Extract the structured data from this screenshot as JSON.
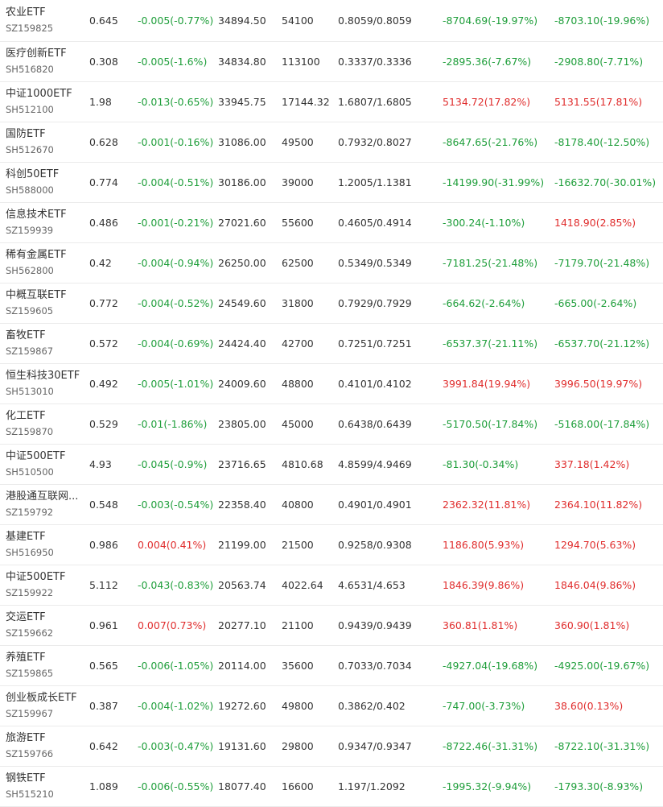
{
  "colors": {
    "up": "#e02d2d",
    "down": "#1e9e3a",
    "text": "#333333",
    "subtext": "#666666"
  },
  "rows": [
    {
      "name": "农业ETF",
      "code": "SZ159825",
      "price": "0.645",
      "change": "-0.005(-0.77%)",
      "dir": "down",
      "amount": "34894.50",
      "volume": "54100",
      "range": "0.8059/0.8059",
      "pl1": "-8704.69(-19.97%)",
      "pl1dir": "down",
      "pl2": "-8703.10(-19.96%)",
      "pl2dir": "down"
    },
    {
      "name": "医疗创新ETF",
      "code": "SH516820",
      "price": "0.308",
      "change": "-0.005(-1.6%)",
      "dir": "down",
      "amount": "34834.80",
      "volume": "113100",
      "range": "0.3337/0.3336",
      "pl1": "-2895.36(-7.67%)",
      "pl1dir": "down",
      "pl2": "-2908.80(-7.71%)",
      "pl2dir": "down"
    },
    {
      "name": "中证1000ETF",
      "code": "SH512100",
      "price": "1.98",
      "change": "-0.013(-0.65%)",
      "dir": "down",
      "amount": "33945.75",
      "volume": "17144.32",
      "range": "1.6807/1.6805",
      "pl1": "5134.72(17.82%)",
      "pl1dir": "up",
      "pl2": "5131.55(17.81%)",
      "pl2dir": "up"
    },
    {
      "name": "国防ETF",
      "code": "SH512670",
      "price": "0.628",
      "change": "-0.001(-0.16%)",
      "dir": "down",
      "amount": "31086.00",
      "volume": "49500",
      "range": "0.7932/0.8027",
      "pl1": "-8647.65(-21.76%)",
      "pl1dir": "down",
      "pl2": "-8178.40(-12.50%)",
      "pl2dir": "down"
    },
    {
      "name": "科创50ETF",
      "code": "SH588000",
      "price": "0.774",
      "change": "-0.004(-0.51%)",
      "dir": "down",
      "amount": "30186.00",
      "volume": "39000",
      "range": "1.2005/1.1381",
      "pl1": "-14199.90(-31.99%)",
      "pl1dir": "down",
      "pl2": "-16632.70(-30.01%)",
      "pl2dir": "down"
    },
    {
      "name": "信息技术ETF",
      "code": "SZ159939",
      "price": "0.486",
      "change": "-0.001(-0.21%)",
      "dir": "down",
      "amount": "27021.60",
      "volume": "55600",
      "range": "0.4605/0.4914",
      "pl1": "-300.24(-1.10%)",
      "pl1dir": "down",
      "pl2": "1418.90(2.85%)",
      "pl2dir": "up"
    },
    {
      "name": "稀有金属ETF",
      "code": "SH562800",
      "price": "0.42",
      "change": "-0.004(-0.94%)",
      "dir": "down",
      "amount": "26250.00",
      "volume": "62500",
      "range": "0.5349/0.5349",
      "pl1": "-7181.25(-21.48%)",
      "pl1dir": "down",
      "pl2": "-7179.70(-21.48%)",
      "pl2dir": "down"
    },
    {
      "name": "中概互联ETF",
      "code": "SZ159605",
      "price": "0.772",
      "change": "-0.004(-0.52%)",
      "dir": "down",
      "amount": "24549.60",
      "volume": "31800",
      "range": "0.7929/0.7929",
      "pl1": "-664.62(-2.64%)",
      "pl1dir": "down",
      "pl2": "-665.00(-2.64%)",
      "pl2dir": "down"
    },
    {
      "name": "畜牧ETF",
      "code": "SZ159867",
      "price": "0.572",
      "change": "-0.004(-0.69%)",
      "dir": "down",
      "amount": "24424.40",
      "volume": "42700",
      "range": "0.7251/0.7251",
      "pl1": "-6537.37(-21.11%)",
      "pl1dir": "down",
      "pl2": "-6537.70(-21.12%)",
      "pl2dir": "down"
    },
    {
      "name": "恒生科技30ETF",
      "code": "SH513010",
      "price": "0.492",
      "change": "-0.005(-1.01%)",
      "dir": "down",
      "amount": "24009.60",
      "volume": "48800",
      "range": "0.4101/0.4102",
      "pl1": "3991.84(19.94%)",
      "pl1dir": "up",
      "pl2": "3996.50(19.97%)",
      "pl2dir": "up"
    },
    {
      "name": "化工ETF",
      "code": "SZ159870",
      "price": "0.529",
      "change": "-0.01(-1.86%)",
      "dir": "down",
      "amount": "23805.00",
      "volume": "45000",
      "range": "0.6438/0.6439",
      "pl1": "-5170.50(-17.84%)",
      "pl1dir": "down",
      "pl2": "-5168.00(-17.84%)",
      "pl2dir": "down"
    },
    {
      "name": "中证500ETF",
      "code": "SH510500",
      "price": "4.93",
      "change": "-0.045(-0.9%)",
      "dir": "down",
      "amount": "23716.65",
      "volume": "4810.68",
      "range": "4.8599/4.9469",
      "pl1": "-81.30(-0.34%)",
      "pl1dir": "down",
      "pl2": "337.18(1.42%)",
      "pl2dir": "up"
    },
    {
      "name": "港股通互联网...",
      "code": "SZ159792",
      "price": "0.548",
      "change": "-0.003(-0.54%)",
      "dir": "down",
      "amount": "22358.40",
      "volume": "40800",
      "range": "0.4901/0.4901",
      "pl1": "2362.32(11.81%)",
      "pl1dir": "up",
      "pl2": "2364.10(11.82%)",
      "pl2dir": "up"
    },
    {
      "name": "基建ETF",
      "code": "SH516950",
      "price": "0.986",
      "change": "0.004(0.41%)",
      "dir": "up",
      "amount": "21199.00",
      "volume": "21500",
      "range": "0.9258/0.9308",
      "pl1": "1186.80(5.93%)",
      "pl1dir": "up",
      "pl2": "1294.70(5.63%)",
      "pl2dir": "up"
    },
    {
      "name": "中证500ETF",
      "code": "SZ159922",
      "price": "5.112",
      "change": "-0.043(-0.83%)",
      "dir": "down",
      "amount": "20563.74",
      "volume": "4022.64",
      "range": "4.6531/4.653",
      "pl1": "1846.39(9.86%)",
      "pl1dir": "up",
      "pl2": "1846.04(9.86%)",
      "pl2dir": "up"
    },
    {
      "name": "交运ETF",
      "code": "SZ159662",
      "price": "0.961",
      "change": "0.007(0.73%)",
      "dir": "up",
      "amount": "20277.10",
      "volume": "21100",
      "range": "0.9439/0.9439",
      "pl1": "360.81(1.81%)",
      "pl1dir": "up",
      "pl2": "360.90(1.81%)",
      "pl2dir": "up"
    },
    {
      "name": "养殖ETF",
      "code": "SZ159865",
      "price": "0.565",
      "change": "-0.006(-1.05%)",
      "dir": "down",
      "amount": "20114.00",
      "volume": "35600",
      "range": "0.7033/0.7034",
      "pl1": "-4927.04(-19.68%)",
      "pl1dir": "down",
      "pl2": "-4925.00(-19.67%)",
      "pl2dir": "down"
    },
    {
      "name": "创业板成长ETF",
      "code": "SZ159967",
      "price": "0.387",
      "change": "-0.004(-1.02%)",
      "dir": "down",
      "amount": "19272.60",
      "volume": "49800",
      "range": "0.3862/0.402",
      "pl1": "-747.00(-3.73%)",
      "pl1dir": "down",
      "pl2": "38.60(0.13%)",
      "pl2dir": "up"
    },
    {
      "name": "旅游ETF",
      "code": "SZ159766",
      "price": "0.642",
      "change": "-0.003(-0.47%)",
      "dir": "down",
      "amount": "19131.60",
      "volume": "29800",
      "range": "0.9347/0.9347",
      "pl1": "-8722.46(-31.31%)",
      "pl1dir": "down",
      "pl2": "-8722.10(-31.31%)",
      "pl2dir": "down"
    },
    {
      "name": "钢铁ETF",
      "code": "SH515210",
      "price": "1.089",
      "change": "-0.006(-0.55%)",
      "dir": "down",
      "amount": "18077.40",
      "volume": "16600",
      "range": "1.197/1.2092",
      "pl1": "-1995.32(-9.94%)",
      "pl1dir": "down",
      "pl2": "-1793.30(-8.93%)",
      "pl2dir": "down"
    }
  ]
}
